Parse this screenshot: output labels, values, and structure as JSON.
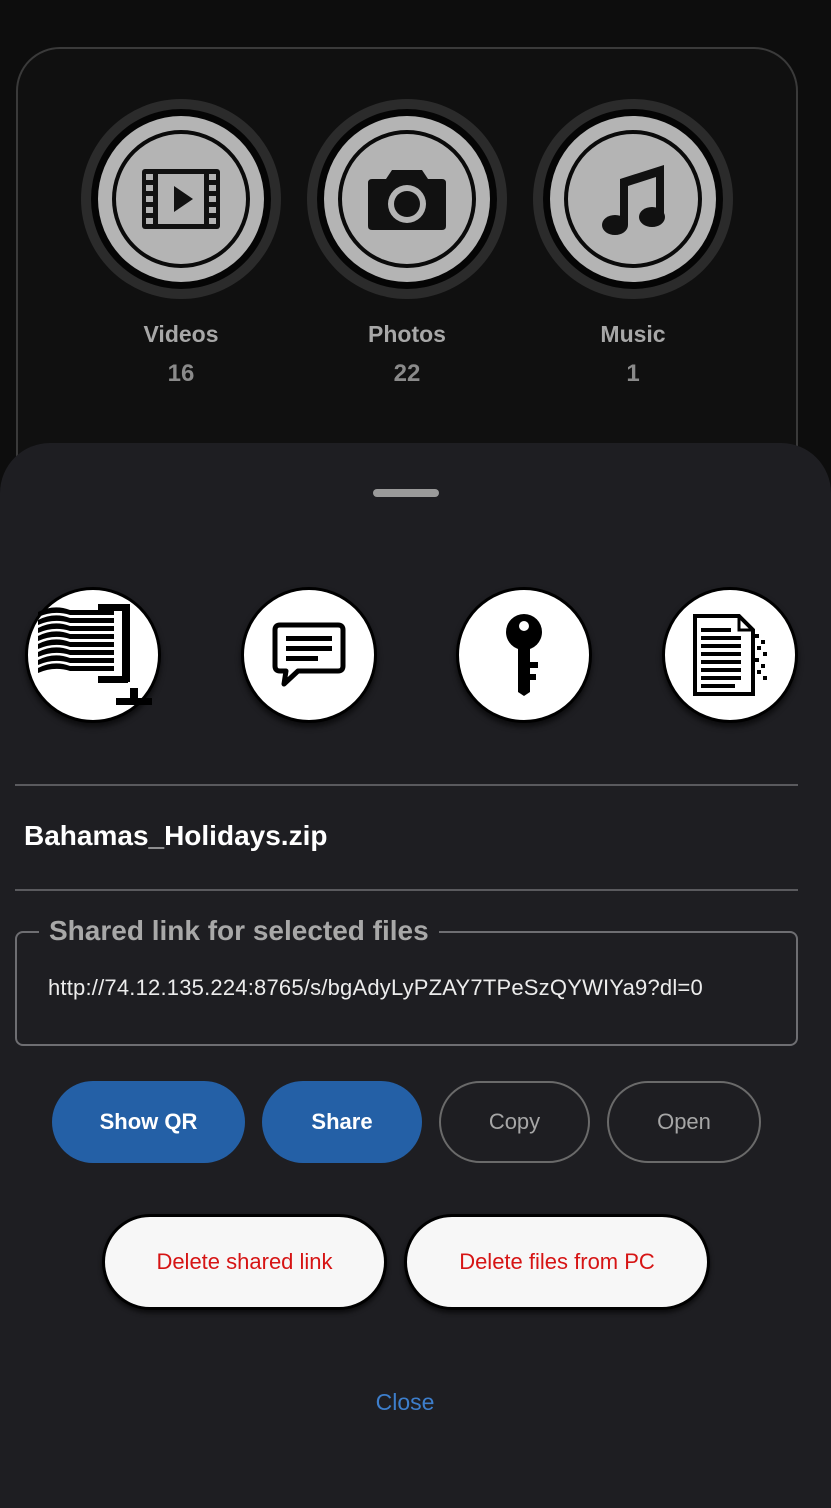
{
  "categories": [
    {
      "label": "Videos",
      "count": "16",
      "icon": "film-icon"
    },
    {
      "label": "Photos",
      "count": "22",
      "icon": "camera-icon"
    },
    {
      "label": "Music",
      "count": "1",
      "icon": "music-note-icon"
    }
  ],
  "sheet": {
    "actions": [
      {
        "icon": "compress-icon"
      },
      {
        "icon": "message-icon"
      },
      {
        "icon": "key-icon"
      },
      {
        "icon": "document-shred-icon"
      }
    ],
    "filename": "Bahamas_Holidays.zip",
    "link_legend": "Shared link for selected files",
    "link_url": "http://74.12.135.224:8765/s/bgAdyLyPZAY7TPeSzQYWIYa9?dl=0",
    "buttons": {
      "show_qr": "Show QR",
      "share": "Share",
      "copy": "Copy",
      "open": "Open",
      "delete_link": "Delete shared link",
      "delete_files": "Delete files from PC",
      "close": "Close"
    }
  },
  "colors": {
    "accent_blue": "#2460a6",
    "danger_red": "#d61414",
    "sheet_bg": "#1e1e22"
  }
}
